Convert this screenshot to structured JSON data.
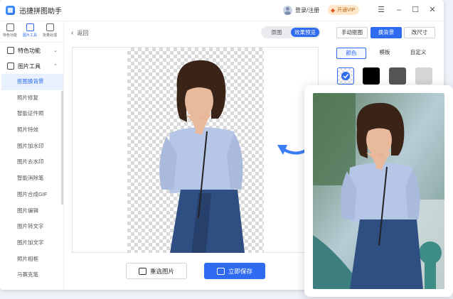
{
  "app": {
    "title": "迅捷拼图助手"
  },
  "header": {
    "login_label": "登录/注册",
    "vip_label": "开通VIP",
    "window_controls": [
      "menu-icon",
      "minimize-icon",
      "maximize-icon",
      "close-icon"
    ]
  },
  "leftbar": {
    "top_tabs": [
      {
        "label": "特色功能",
        "icon": "grid-icon"
      },
      {
        "label": "图片工具",
        "icon": "image-tool-icon"
      },
      {
        "label": "批量处理",
        "icon": "batch-icon"
      }
    ],
    "section_features": "特色功能",
    "section_tools": "图片工具",
    "items": [
      "抠图换背景",
      "照片修复",
      "智能证件照",
      "照片特效",
      "图片加水印",
      "图片去水印",
      "智能消除笔",
      "图片合成GIF",
      "图片编辑",
      "图片转文字",
      "图片加文字",
      "照片相框",
      "马赛克笔"
    ]
  },
  "main": {
    "back_label": "返回",
    "view_toggle": [
      "原图",
      "效果预览"
    ],
    "reselect_label": "重选图片",
    "save_label": "立即保存"
  },
  "right_panel": {
    "mode_buttons": [
      "手动抠图",
      "换背景",
      "改尺寸"
    ],
    "sub_tabs": [
      "颜色",
      "模板",
      "自定义"
    ],
    "swatches": [
      "#ffffff",
      "#000000",
      "#555555",
      "#d6d6d6"
    ]
  },
  "colors": {
    "accent": "#2e6bf0"
  }
}
